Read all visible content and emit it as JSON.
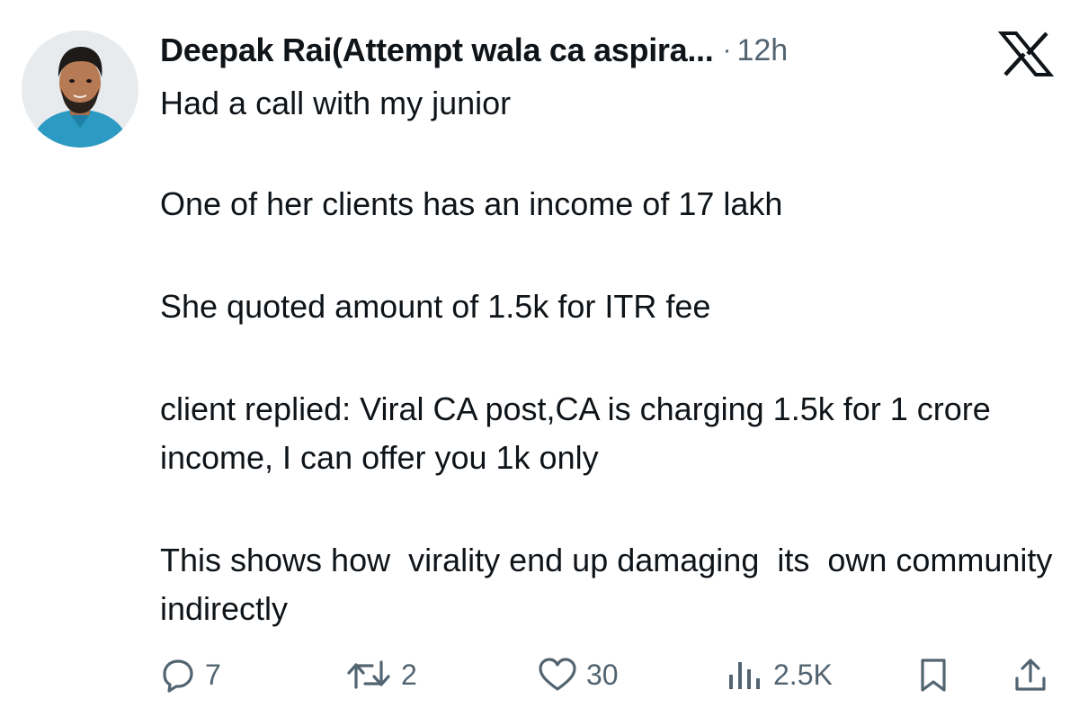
{
  "post": {
    "author": "Deepak Rai(Attempt wala ca aspira...",
    "separator": "·",
    "time": "12h",
    "paragraphs": [
      "Had a call with my junior",
      "One of her clients has an income of 17 lakh",
      "She quoted amount of 1.5k for ITR fee",
      "client replied: Viral CA post,CA is charging 1.5k for 1 crore income, I can offer you 1k only",
      "This shows how  virality end up damaging  its  own community indirectly"
    ]
  },
  "actions": {
    "replies": "7",
    "reposts": "2",
    "likes": "30",
    "views": "2.5K"
  },
  "icons": {
    "close": "x-logo-icon",
    "reply": "reply-icon",
    "repost": "repost-icon",
    "like": "heart-icon",
    "views": "analytics-icon",
    "bookmark": "bookmark-icon",
    "share": "share-icon"
  },
  "colors": {
    "text": "#0f1419",
    "muted": "#536471",
    "avatar_shirt": "#2b9bc4"
  }
}
